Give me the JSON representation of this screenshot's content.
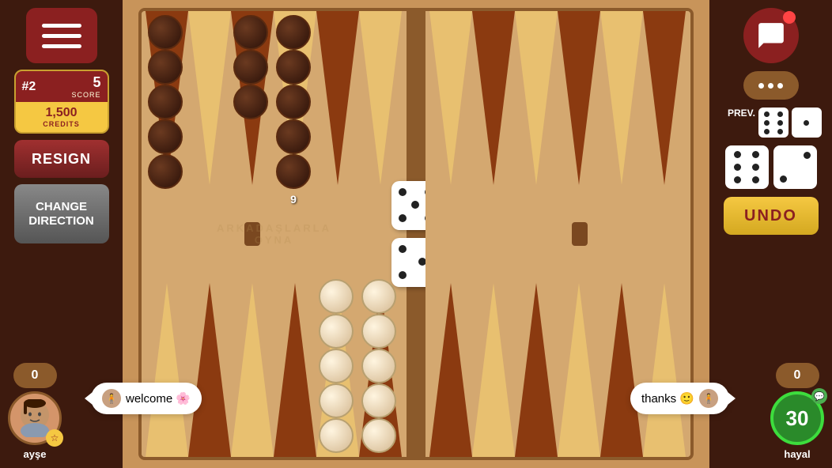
{
  "left_panel": {
    "menu_label": "Menu",
    "rank": "#2",
    "score_value": "5",
    "score_label": "SCORE",
    "credits_value": "1,500",
    "credits_label": "CREDITS",
    "resign_label": "RESIGN",
    "change_dir_label": "CHANGE DIRECTION"
  },
  "right_panel": {
    "prev_label": "PREV.",
    "undo_label": "UNDO",
    "dots_label": "..."
  },
  "player_left": {
    "name": "ayşe",
    "score": "0",
    "chat_message": "welcome 🌸"
  },
  "player_right": {
    "name": "hayal",
    "score": "0",
    "timer": "30",
    "chat_message": "thanks 🙂"
  },
  "board": {
    "watermark": "ARKADAŞLARLA OYNA"
  },
  "dice": {
    "current_left": "5",
    "current_right": "3"
  }
}
